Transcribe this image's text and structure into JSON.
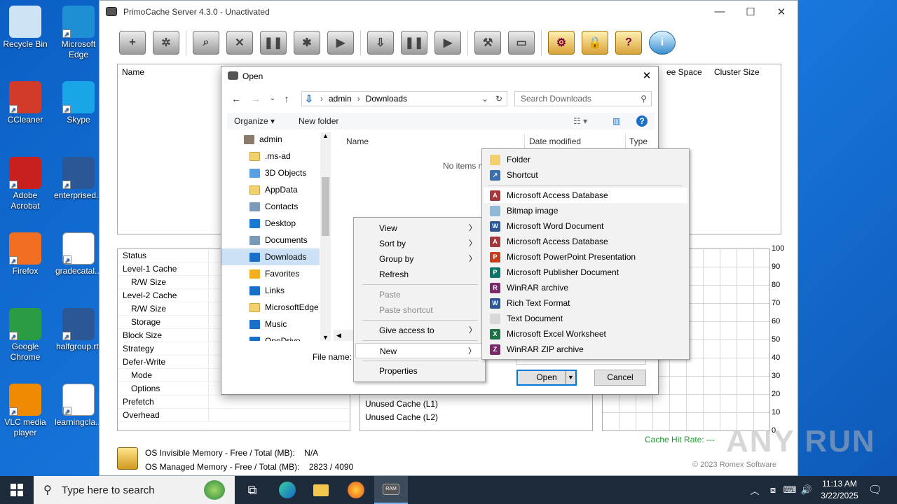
{
  "desktop": {
    "icons": [
      {
        "label": "Recycle Bin",
        "icon": "recycle-bin-icon",
        "color": "#cfe3f7"
      },
      {
        "label": "Microsoft Edge",
        "icon": "edge-icon",
        "color": "#1f8fd4"
      },
      {
        "label": "CCleaner",
        "icon": "ccleaner-icon",
        "color": "#d23a2a"
      },
      {
        "label": "Skype",
        "icon": "skype-icon",
        "color": "#1aa5e8"
      },
      {
        "label": "Adobe Acrobat",
        "icon": "acrobat-icon",
        "color": "#c8201f"
      },
      {
        "label": "enterprised...",
        "icon": "word-doc-icon",
        "color": "#2b5797"
      },
      {
        "label": "Firefox",
        "icon": "firefox-icon",
        "color": "#f26f21"
      },
      {
        "label": "gradecatal...",
        "icon": "image-file-icon",
        "color": "#ffffff"
      },
      {
        "label": "Google Chrome",
        "icon": "chrome-icon",
        "color": "#2a9c44"
      },
      {
        "label": "halfgroup.rtf",
        "icon": "word-doc-icon",
        "color": "#2b5797"
      },
      {
        "label": "VLC media player",
        "icon": "vlc-icon",
        "color": "#f08a00"
      },
      {
        "label": "learningcla...",
        "icon": "image-file-icon",
        "color": "#ffffff"
      }
    ]
  },
  "primo": {
    "title": "PrimoCache Server 4.3.0 - Unactivated",
    "volume_headers": {
      "name": "Name",
      "free_space": "ee Space",
      "cluster_size": "Cluster Size"
    },
    "stats_rows": [
      {
        "label": "Status",
        "indent": false
      },
      {
        "label": "Level-1 Cache",
        "indent": false
      },
      {
        "label": "R/W Size",
        "indent": true
      },
      {
        "label": "Level-2 Cache",
        "indent": false
      },
      {
        "label": "R/W Size",
        "indent": true
      },
      {
        "label": "Storage",
        "indent": true
      },
      {
        "label": "Block Size",
        "indent": false
      },
      {
        "label": "Strategy",
        "indent": false
      },
      {
        "label": "Defer-Write",
        "indent": false
      },
      {
        "label": "Mode",
        "indent": true
      },
      {
        "label": "Options",
        "indent": true
      },
      {
        "label": "Prefetch",
        "indent": false
      },
      {
        "label": "Overhead",
        "indent": false
      }
    ],
    "mid_rows": [
      "Unused Cache (L1)",
      "Unused Cache (L2)"
    ],
    "chart_y_ticks": [
      "100",
      "90",
      "80",
      "70",
      "60",
      "50",
      "40",
      "30",
      "20",
      "10",
      "0"
    ],
    "hit_rate": "Cache Hit Rate: ---",
    "memory": {
      "invisible_label": "OS Invisible Memory - Free / Total (MB):",
      "invisible_value": "N/A",
      "managed_label": "OS Managed Memory - Free / Total (MB):",
      "managed_value": "2823 / 4090"
    },
    "copyright": "© 2023 Romex Software"
  },
  "dialog": {
    "title": "Open",
    "address": {
      "root": "admin",
      "folder": "Downloads"
    },
    "search_placeholder": "Search Downloads",
    "organize": "Organize",
    "new_folder": "New folder",
    "nav_items": [
      {
        "label": "admin",
        "selected": false
      },
      {
        "label": ".ms-ad",
        "selected": false
      },
      {
        "label": "3D Objects",
        "selected": false
      },
      {
        "label": "AppData",
        "selected": false
      },
      {
        "label": "Contacts",
        "selected": false
      },
      {
        "label": "Desktop",
        "selected": false
      },
      {
        "label": "Documents",
        "selected": false
      },
      {
        "label": "Downloads",
        "selected": true
      },
      {
        "label": "Favorites",
        "selected": false
      },
      {
        "label": "Links",
        "selected": false
      },
      {
        "label": "MicrosoftEdge",
        "selected": false
      },
      {
        "label": "Music",
        "selected": false
      },
      {
        "label": "OneDrive",
        "selected": false
      }
    ],
    "columns": {
      "name": "Name",
      "date": "Date modified",
      "type": "Type"
    },
    "empty_text": "No items m",
    "file_name_label": "File name:",
    "open_label": "Open",
    "cancel_label": "Cancel"
  },
  "context_menu": {
    "items": [
      {
        "label": "View",
        "submenu": true,
        "disabled": false
      },
      {
        "label": "Sort by",
        "submenu": true,
        "disabled": false
      },
      {
        "label": "Group by",
        "submenu": true,
        "disabled": false
      },
      {
        "label": "Refresh",
        "submenu": false,
        "disabled": false
      },
      {
        "label": "Paste",
        "submenu": false,
        "disabled": true
      },
      {
        "label": "Paste shortcut",
        "submenu": false,
        "disabled": true
      },
      {
        "label": "Give access to",
        "submenu": true,
        "disabled": false
      },
      {
        "label": "New",
        "submenu": true,
        "disabled": false
      },
      {
        "label": "Properties",
        "submenu": false,
        "disabled": false
      }
    ]
  },
  "new_submenu": {
    "items": [
      {
        "label": "Folder",
        "icon": "folder-icon",
        "color": "#f3d06e"
      },
      {
        "label": "Shortcut",
        "icon": "shortcut-icon",
        "color": "#3a6fb0"
      },
      {
        "label": "Microsoft Access Database",
        "icon": "access-icon",
        "color": "#a4373a"
      },
      {
        "label": "Bitmap image",
        "icon": "bitmap-icon",
        "color": "#8fb8d8"
      },
      {
        "label": "Microsoft Word Document",
        "icon": "word-icon",
        "color": "#2b5797"
      },
      {
        "label": "Microsoft Access Database",
        "icon": "access-icon",
        "color": "#a4373a"
      },
      {
        "label": "Microsoft PowerPoint Presentation",
        "icon": "powerpoint-icon",
        "color": "#c43e1c"
      },
      {
        "label": "Microsoft Publisher Document",
        "icon": "publisher-icon",
        "color": "#077568"
      },
      {
        "label": "WinRAR archive",
        "icon": "winrar-icon",
        "color": "#7a2a6a"
      },
      {
        "label": "Rich Text Format",
        "icon": "rtf-icon",
        "color": "#2b5797"
      },
      {
        "label": "Text Document",
        "icon": "text-doc-icon",
        "color": "#d8d8d8"
      },
      {
        "label": "Microsoft Excel Worksheet",
        "icon": "excel-icon",
        "color": "#1e7145"
      },
      {
        "label": "WinRAR ZIP archive",
        "icon": "winrar-zip-icon",
        "color": "#7a2a6a"
      }
    ]
  },
  "taskbar": {
    "search_placeholder": "Type here to search",
    "time": "11:13 AM",
    "date": "3/22/2025"
  },
  "watermark": "ANY RUN"
}
